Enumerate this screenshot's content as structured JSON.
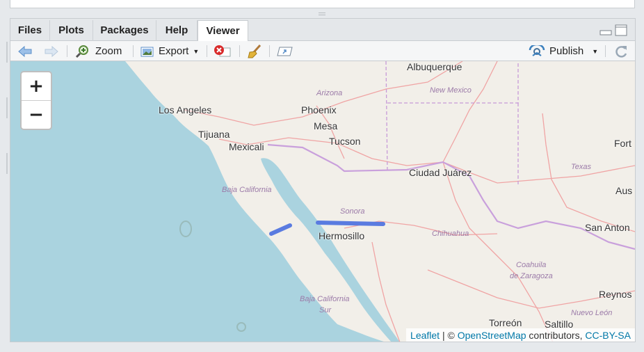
{
  "tabs": [
    {
      "label": "Files"
    },
    {
      "label": "Plots"
    },
    {
      "label": "Packages"
    },
    {
      "label": "Help"
    },
    {
      "label": "Viewer"
    }
  ],
  "toolbar": {
    "zoom_label": "Zoom",
    "export_label": "Export",
    "publish_label": "Publish"
  },
  "map": {
    "zoom_in": "+",
    "zoom_out": "−",
    "cities": {
      "albuquerque": "Albuquerque",
      "los_angeles": "Los Angeles",
      "phoenix": "Phoenix",
      "mesa": "Mesa",
      "tijuana": "Tijuana",
      "mexicali": "Mexicali",
      "tucson": "Tucson",
      "ciudad_juarez": "Ciudad Juárez",
      "fort": "Fort",
      "aus": "Aus",
      "san_anton": "San Anton",
      "hermosillo": "Hermosillo",
      "reynos": "Reynos",
      "torreon": "Torreón",
      "saltillo": "Saltillo"
    },
    "regions": {
      "arizona": "Arizona",
      "new_mexico": "New Mexico",
      "texas": "Texas",
      "baja_california": "Baja California",
      "sonora": "Sonora",
      "chihuahua": "Chihuahua",
      "coahuila_1": "Coahuila",
      "coahuila_2": "de Zaragoza",
      "baja_california_sur_1": "Baja California",
      "baja_california_sur_2": "Sur",
      "nuevo_leon": "Nuevo León"
    },
    "attribution": {
      "leaflet": "Leaflet",
      "sep": " | © ",
      "osm": "OpenStreetMap",
      "contributors": " contributors, ",
      "license": "CC-BY-SA"
    }
  },
  "colors": {
    "sea": "#aad3df",
    "land": "#f2efe9",
    "route": "#5a7be0",
    "border": "#c79ad8",
    "road": "#f0a4a4"
  }
}
